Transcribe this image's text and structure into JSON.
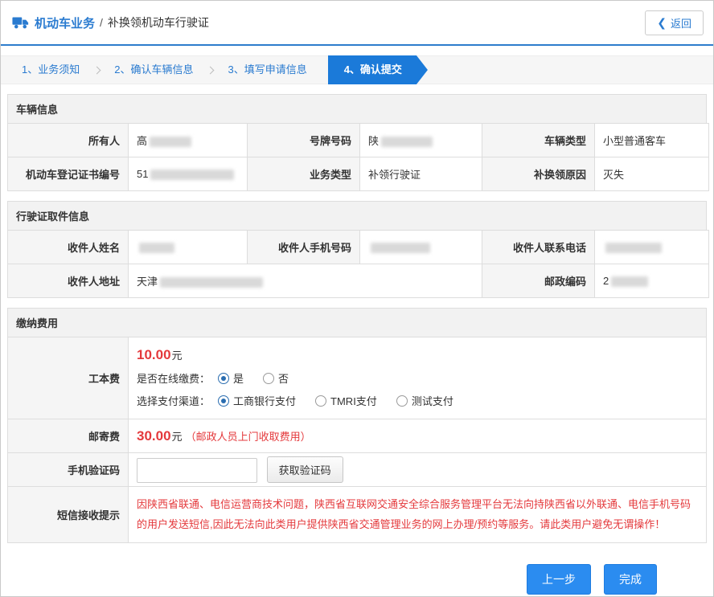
{
  "header": {
    "brand": "机动车业务",
    "separator": "/",
    "subtitle": "补换领机动车行驶证",
    "back_label": "返回"
  },
  "steps": {
    "items": [
      {
        "label": "1、业务须知"
      },
      {
        "label": "2、确认车辆信息"
      },
      {
        "label": "3、填写申请信息"
      },
      {
        "label": "4、确认提交"
      }
    ],
    "active_step": "4、确认提交"
  },
  "vehicle": {
    "title": "车辆信息",
    "owner": {
      "label": "所有人",
      "value": "高"
    },
    "plate": {
      "label": "号牌号码",
      "value": "陕"
    },
    "vtype": {
      "label": "车辆类型",
      "value": "小型普通客车"
    },
    "cert": {
      "label": "机动车登记证书编号",
      "value": "51"
    },
    "biz": {
      "label": "业务类型",
      "value": "补领行驶证"
    },
    "reason": {
      "label": "补换领原因",
      "value": "灭失"
    }
  },
  "pickup": {
    "title": "行驶证取件信息",
    "name": {
      "label": "收件人姓名",
      "value": ""
    },
    "mobile": {
      "label": "收件人手机号码",
      "value": ""
    },
    "phone": {
      "label": "收件人联系电话",
      "value": ""
    },
    "address": {
      "label": "收件人地址",
      "value": "天津"
    },
    "postal": {
      "label": "邮政编码",
      "value": "2"
    }
  },
  "fees": {
    "title": "缴纳费用",
    "production": {
      "label": "工本费",
      "amount": "10.00",
      "unit": "元",
      "online_question": "是否在线缴费：",
      "option_yes": "是",
      "option_no": "否",
      "selected_online": "是",
      "channel_question": "选择支付渠道：",
      "channel_icbc": "工商银行支付",
      "channel_tmri": "TMRI支付",
      "channel_test": "测试支付",
      "selected_channel": "工商银行支付"
    },
    "postage": {
      "label": "邮寄费",
      "amount": "30.00",
      "unit": "元",
      "note": "（邮政人员上门收取费用）"
    },
    "sms_code": {
      "label": "手机验证码",
      "input_value": "",
      "button_label": "获取验证码"
    },
    "notice": {
      "label": "短信接收提示",
      "text": "因陕西省联通、电信运营商技术问题，陕西省互联网交通安全综合服务管理平台无法向持陕西省以外联通、电信手机号码的用户发送短信,因此无法向此类用户提供陕西省交通管理业务的网上办理/预约等服务。请此类用户避免无谓操作！"
    }
  },
  "footer": {
    "prev_label": "上一步",
    "done_label": "完成"
  },
  "colors": {
    "accent_blue": "#2a7bd0",
    "active_step_blue": "#1b7ad9",
    "button_blue": "#2b8cf0",
    "danger_red": "#e4393c"
  }
}
